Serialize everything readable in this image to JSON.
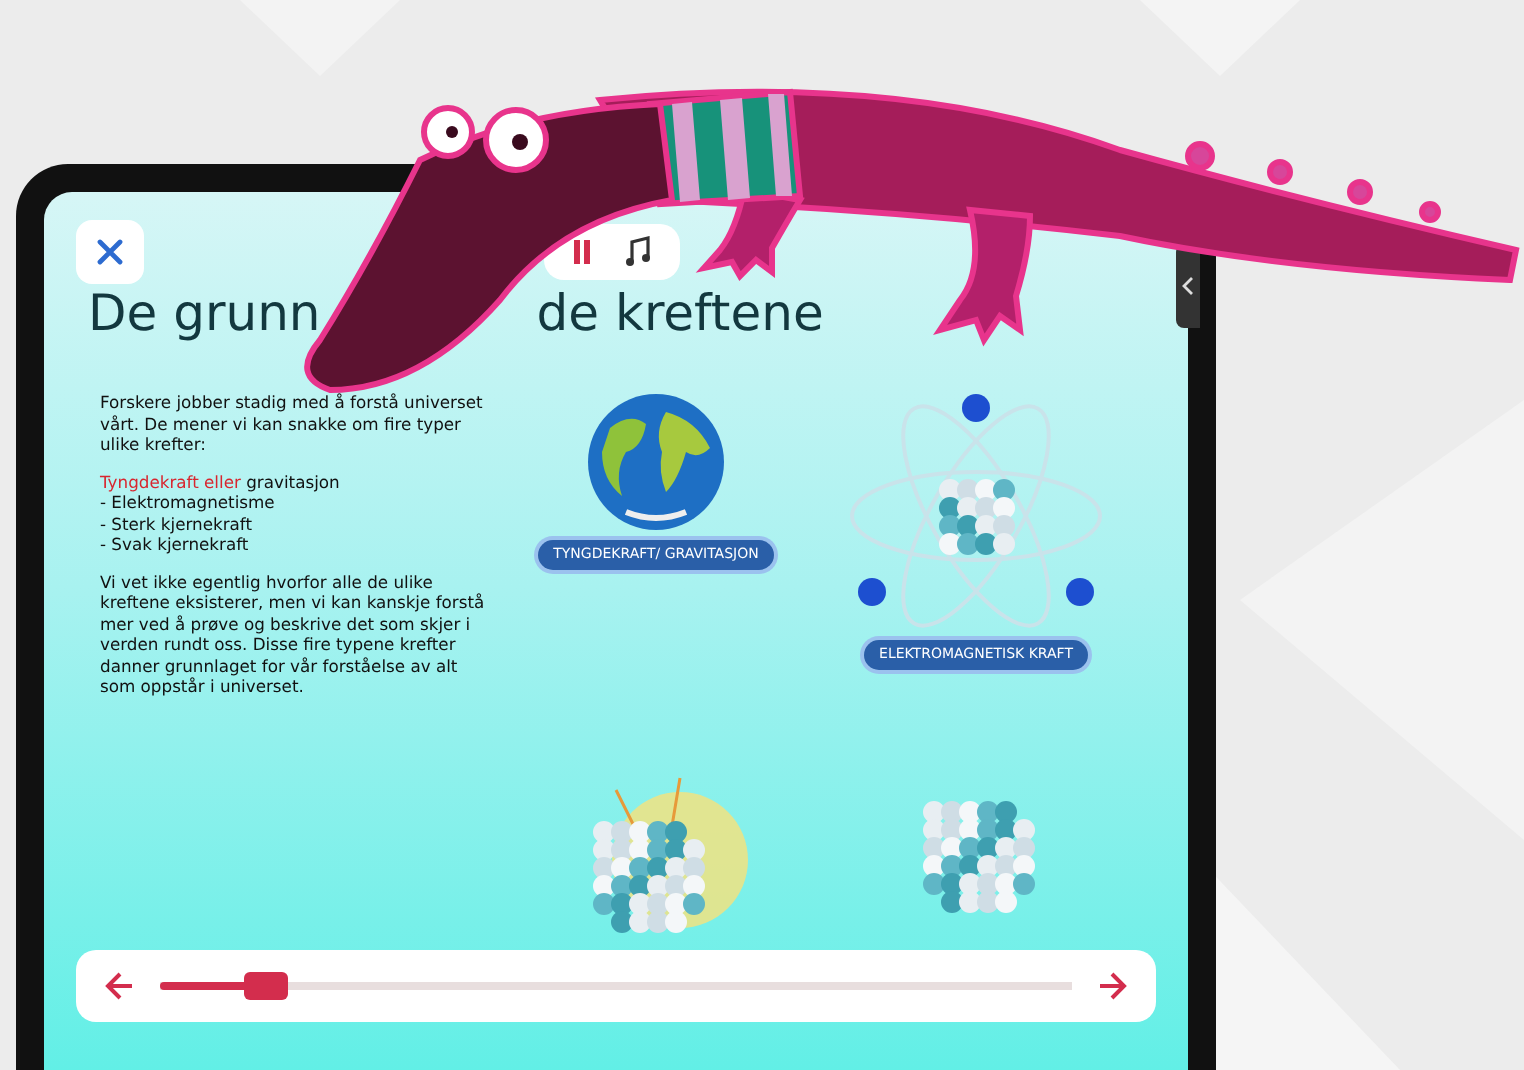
{
  "slide": {
    "title_parts": [
      "De grunn",
      "de kreftene"
    ],
    "intro": "Forskere jobber stadig med å forstå universet vårt. De mener vi kan snakke om fire typer ulike krefter:",
    "forces": [
      {
        "highlight": "Tyngdekraft eller",
        "text": "gravitasjon"
      },
      {
        "text": "- Elektromagnetisme"
      },
      {
        "text": "- Sterk kjernekraft"
      },
      {
        "text": "- Svak kjernekraft"
      }
    ],
    "outro": "Vi vet ikke egentlig hvorfor alle de ulike kreftene eksisterer, men vi kan kanskje forstå mer ved å prøve og beskrive det som skjer i verden rundt oss. Disse fire typene krefter danner grunnlaget for vår forståelse av alt som oppstår i universet.",
    "illustrations": [
      {
        "kind": "globe",
        "label": "TYNGDEKRAFT/ GRAVITASJON"
      },
      {
        "kind": "atom",
        "label": "ELEKTROMAGNETISK KRAFT"
      },
      {
        "kind": "nucleus_glow"
      },
      {
        "kind": "nucleus"
      }
    ]
  },
  "progress": {
    "level": 0.1
  }
}
